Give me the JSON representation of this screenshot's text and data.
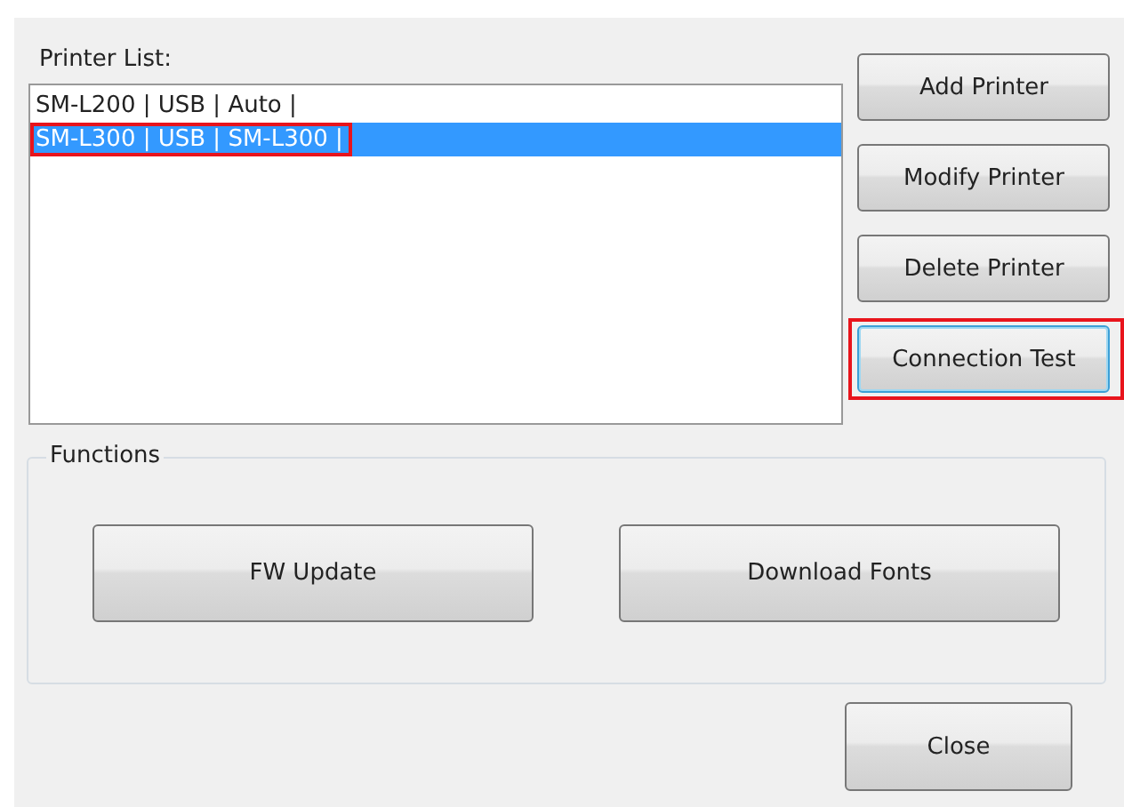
{
  "printer_list": {
    "label": "Printer List:",
    "items": [
      {
        "text": "SM-L200 | USB | Auto |",
        "selected": false,
        "highlighted": false
      },
      {
        "text": "SM-L300 | USB | SM-L300 |",
        "selected": true,
        "highlighted": true
      }
    ]
  },
  "side_buttons": [
    {
      "label": "Add Printer",
      "focused": false,
      "highlighted": false
    },
    {
      "label": "Modify Printer",
      "focused": false,
      "highlighted": false
    },
    {
      "label": "Delete Printer",
      "focused": false,
      "highlighted": false
    },
    {
      "label": "Connection Test",
      "focused": true,
      "highlighted": true
    }
  ],
  "functions": {
    "title": "Functions",
    "buttons": [
      "FW Update",
      "Download Fonts"
    ]
  },
  "close_button": "Close"
}
